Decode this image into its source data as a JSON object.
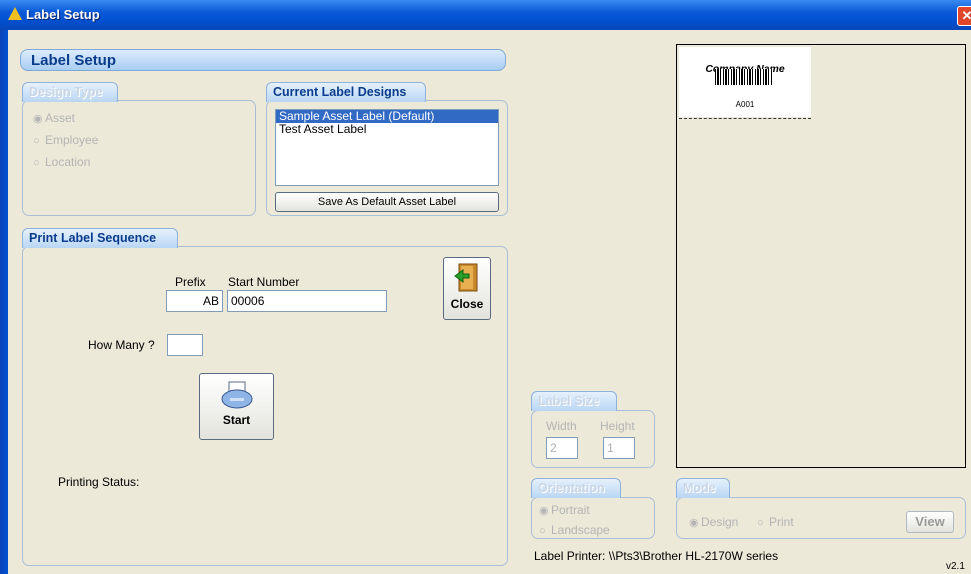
{
  "window": {
    "title": "Label Setup",
    "close_glyph": "✕"
  },
  "header": {
    "title": "Label Setup"
  },
  "design_type": {
    "title": "Design Type",
    "options": [
      {
        "label": "Asset",
        "selected": true
      },
      {
        "label": "Employee",
        "selected": false
      },
      {
        "label": "Location",
        "selected": false
      }
    ]
  },
  "current_designs": {
    "title": "Current Label Designs",
    "items": [
      "Sample Asset Label  (Default)",
      "Test Asset Label"
    ],
    "selected_index": 0,
    "save_default_label": "Save As Default Asset Label"
  },
  "sequence": {
    "title": "Print Label Sequence",
    "prefix_label": "Prefix",
    "prefix_value": "AB",
    "start_label": "Start Number",
    "start_value": "00006",
    "how_many_label": "How Many ?",
    "how_many_value": "",
    "close_label": "Close",
    "start_button_label": "Start",
    "status_label": "Printing Status:"
  },
  "label_size": {
    "title": "Label Size",
    "width_label": "Width",
    "height_label": "Height",
    "width_value": "2",
    "height_value": "1"
  },
  "orientation": {
    "title": "Orientation",
    "options": [
      {
        "label": "Portrait",
        "selected": true
      },
      {
        "label": "Landscape",
        "selected": false
      }
    ]
  },
  "mode": {
    "title": "Mode",
    "options": [
      {
        "label": "Design",
        "selected": true
      },
      {
        "label": "Print",
        "selected": false
      }
    ],
    "view_label": "View"
  },
  "preview": {
    "company": "Company Name",
    "code": "A001"
  },
  "footer": {
    "printer": "Label Printer:  \\\\Pts3\\Brother HL-2170W series",
    "version": "v2.1"
  },
  "colors": {
    "accent": "#0b3c8c",
    "titlebar": "#0a5ad8",
    "selection": "#316ac5"
  }
}
